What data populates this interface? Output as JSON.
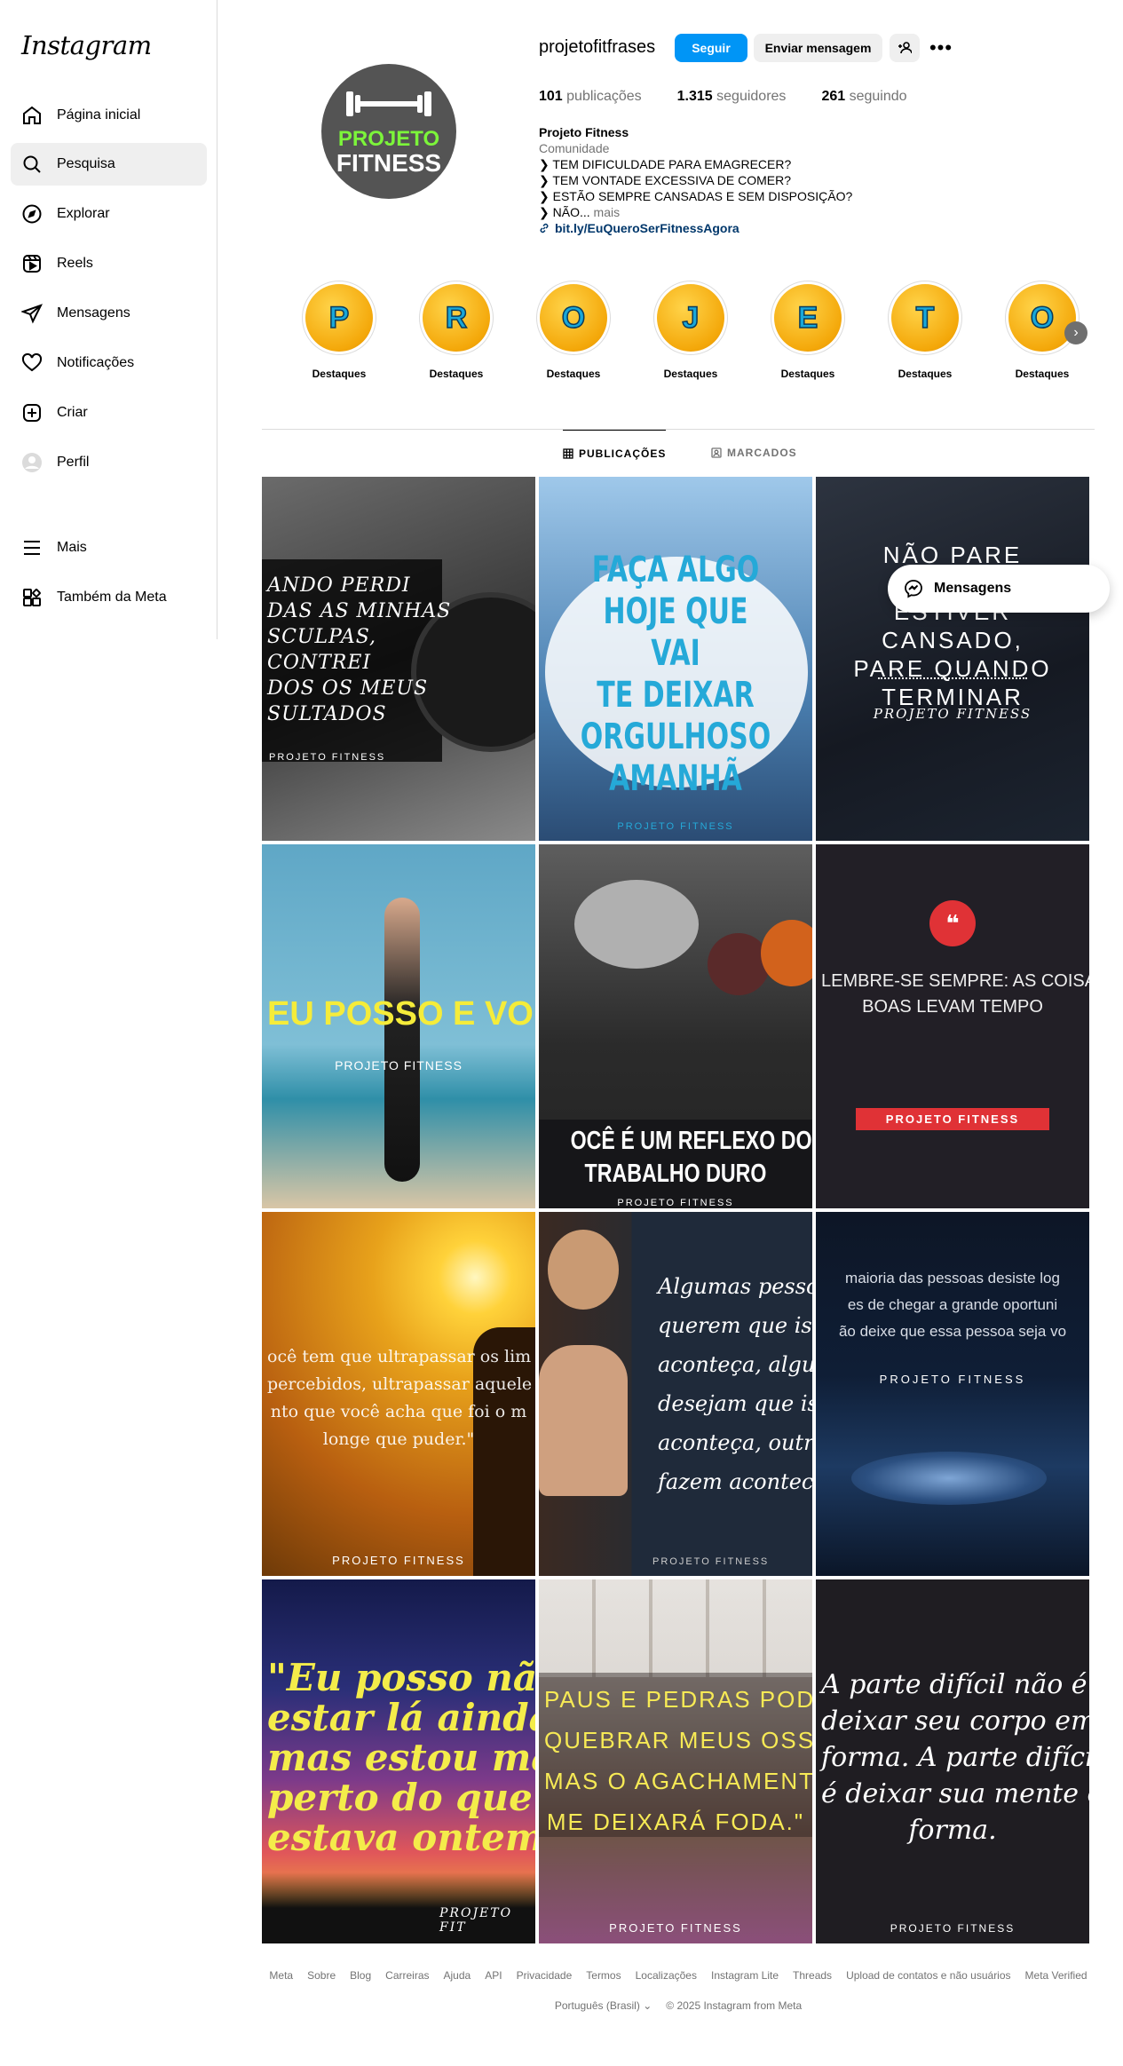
{
  "app": {
    "logo": "Instagram"
  },
  "sidebar": {
    "items": [
      {
        "label": "Página inicial",
        "icon": "home-icon"
      },
      {
        "label": "Pesquisa",
        "icon": "search-icon"
      },
      {
        "label": "Explorar",
        "icon": "compass-icon"
      },
      {
        "label": "Reels",
        "icon": "reels-icon"
      },
      {
        "label": "Mensagens",
        "icon": "send-icon"
      },
      {
        "label": "Notificações",
        "icon": "heart-icon"
      },
      {
        "label": "Criar",
        "icon": "plus-square-icon"
      },
      {
        "label": "Perfil",
        "icon": "avatar-icon"
      },
      {
        "label": "Mais",
        "icon": "menu-icon"
      },
      {
        "label": "Também da Meta",
        "icon": "meta-apps-icon"
      }
    ]
  },
  "profile": {
    "avatar_line1": "PROJETO",
    "avatar_line2": "FITNESS",
    "username": "projetofitfrases",
    "follow_label": "Seguir",
    "message_label": "Enviar mensagem",
    "stats": {
      "posts_count": "101",
      "posts_label": "publicações",
      "followers_count": "1.315",
      "followers_label": "seguidores",
      "following_count": "261",
      "following_label": "seguindo"
    },
    "bio": {
      "name": "Projeto Fitness",
      "category": "Comunidade",
      "lines": [
        "❯ TEM DIFICULDADE PARA EMAGRECER?",
        "❯ TEM VONTADE EXCESSIVA DE COMER?",
        "❯ ESTÃO SEMPRE CANSADAS E SEM DISPOSIÇÃO?",
        "❯ NÃO..."
      ],
      "more": "mais",
      "link": "bit.ly/EuQueroSerFitnessAgora"
    }
  },
  "highlights": [
    {
      "letter": "P",
      "label": "Destaques"
    },
    {
      "letter": "R",
      "label": "Destaques"
    },
    {
      "letter": "O",
      "label": "Destaques"
    },
    {
      "letter": "J",
      "label": "Destaques"
    },
    {
      "letter": "E",
      "label": "Destaques"
    },
    {
      "letter": "T",
      "label": "Destaques"
    },
    {
      "letter": "O",
      "label": "Destaques"
    }
  ],
  "tabs": {
    "posts": "PUBLICAÇÕES",
    "tagged": "MARCADOS"
  },
  "posts": [
    {
      "text": "ANDO PERDI\nDAS AS MINHAS\nSCULPAS,\nCONTREI\nDOS OS MEUS\nSULTADOS",
      "brand": "PROJETO FITNESS"
    },
    {
      "text": "FAÇA ALGO\nHOJE QUE VAI\nTE DEIXAR\nORGULHOSO\nAMANHÃ",
      "brand": "PROJETO FITNESS"
    },
    {
      "text": "NÃO PARE QUANDO\nESTIVER CANSADO,\nPARE QUANDO\nTERMINAR",
      "brand": "PROJETO FITNESS"
    },
    {
      "text": "EU POSSO E VOU",
      "brand": "PROJETO FITNESS"
    },
    {
      "text": "OCÊ É UM REFLEXO DO SE\nTRABALHO DURO",
      "brand": "PROJETO FITNESS"
    },
    {
      "text": "LEMBRE-SE SEMPRE: AS COISAS\nBOAS LEVAM TEMPO",
      "brand": "PROJETO FITNESS"
    },
    {
      "text": "ocê tem que ultrapassar os lim\npercebidos, ultrapassar aquele\nnto que você acha que foi o m\nlonge que puder.\"",
      "brand": "PROJETO FITNESS"
    },
    {
      "text": "Algumas pesso\nquerem que iss\naconteça, algu\ndesejam que iss\naconteça, outro\nfazem acontece",
      "brand": "PROJETO FITNESS"
    },
    {
      "text": "maioria das pessoas desiste log\nes de chegar a grande oportuni\não deixe que essa pessoa seja vo",
      "brand": "PROJETO FITNESS"
    },
    {
      "text": "\"Eu posso não\nestar lá ainda,\nmas estou mai\nperto do que\nestava ontem.",
      "brand": "PROJETO FIT"
    },
    {
      "text": "PAUS E PEDRAS PODEM\nQUEBRAR MEUS OSSOS,\nMAS O AGACHAMENTO\nME DEIXARÁ FODA.\"",
      "brand": "PROJETO FITNESS"
    },
    {
      "text": "A parte difícil não é\ndeixar seu corpo em\nforma. A parte difícil\né deixar sua mente em\nforma.",
      "brand": "PROJETO FITNESS"
    }
  ],
  "floating_messages": {
    "label": "Mensagens"
  },
  "footer": {
    "links": [
      "Meta",
      "Sobre",
      "Blog",
      "Carreiras",
      "Ajuda",
      "API",
      "Privacidade",
      "Termos",
      "Localizações",
      "Instagram Lite",
      "Threads",
      "Upload de contatos e não usuários",
      "Meta Verified"
    ],
    "language": "Português (Brasil)",
    "copyright": "© 2025 Instagram from Meta"
  },
  "colors": {
    "accent": "#0095f6",
    "link": "#00376b",
    "muted": "#737373"
  }
}
